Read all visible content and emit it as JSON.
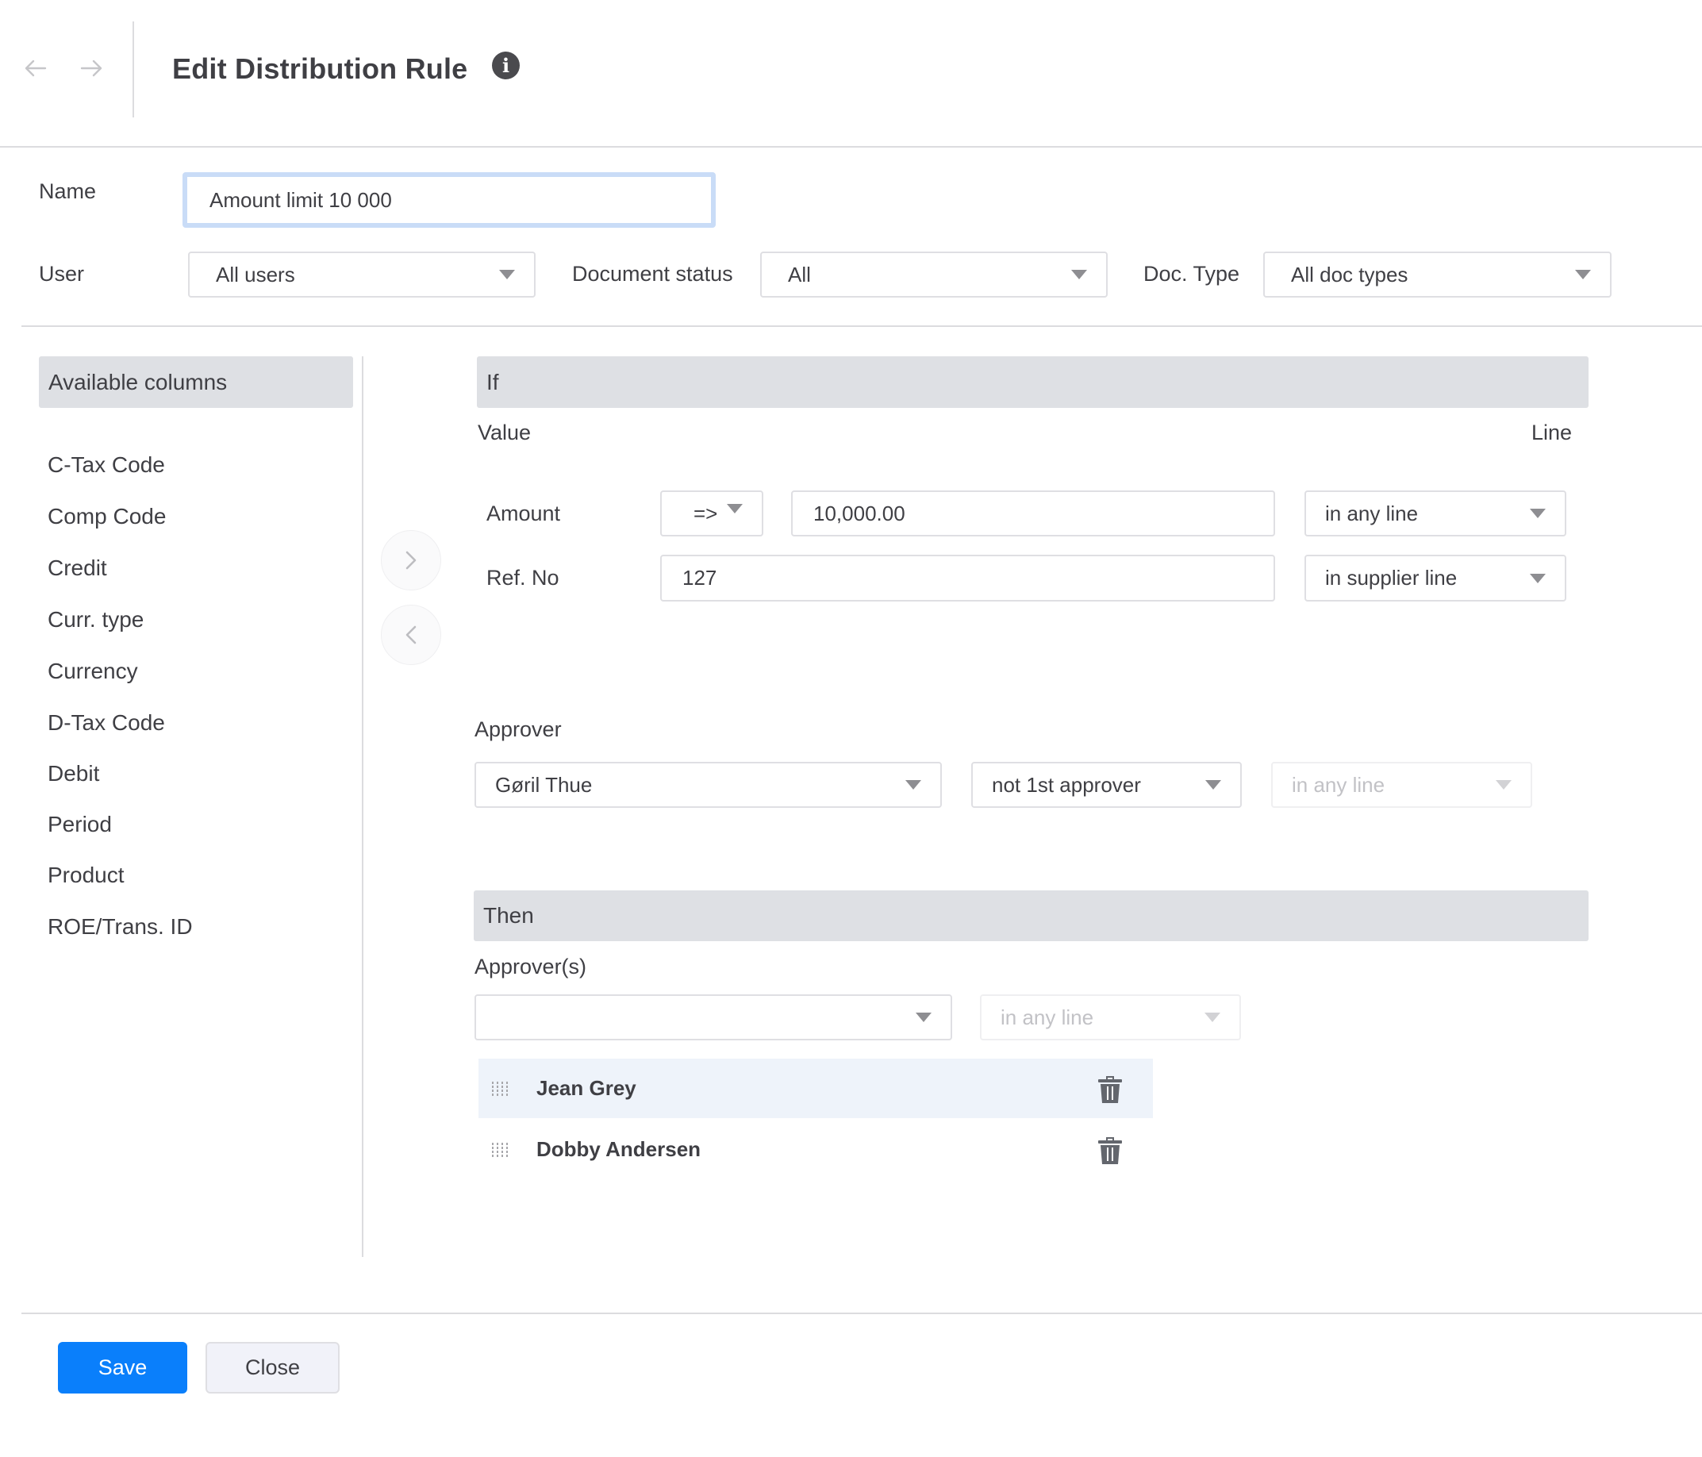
{
  "header": {
    "title": "Edit Distribution Rule",
    "back_icon": "arrow-left-icon",
    "forward_icon": "arrow-right-icon",
    "info_icon": "info-icon"
  },
  "form": {
    "name_label": "Name",
    "name_value": "Amount limit 10 000",
    "user_label": "User",
    "user_value": "All users",
    "doc_status_label": "Document status",
    "doc_status_value": "All",
    "doc_type_label": "Doc. Type",
    "doc_type_value": "All doc types"
  },
  "available_columns": {
    "header": "Available columns",
    "items": [
      "C-Tax Code",
      "Comp Code",
      "Credit",
      "Curr. type",
      "Currency",
      "D-Tax Code",
      "Debit",
      "Period",
      "Product",
      "ROE/Trans. ID"
    ],
    "move_right_icon": "chevron-right-icon",
    "move_left_icon": "chevron-left-icon"
  },
  "if_section": {
    "header": "If",
    "value_label": "Value",
    "line_label": "Line",
    "conditions": [
      {
        "field": "Amount",
        "operator": "=>",
        "value": "10,000.00",
        "line": "in any line"
      },
      {
        "field": "Ref. No",
        "value": "127",
        "line": "in supplier line"
      }
    ],
    "approver_label": "Approver",
    "approver_value": "Gøril Thue",
    "approver_qualifier": "not 1st approver",
    "approver_line": "in any line"
  },
  "then_section": {
    "header": "Then",
    "approvers_label": "Approver(s)",
    "approver_select_value": "",
    "approver_line": "in any line",
    "approvers": [
      {
        "name": "Jean Grey",
        "highlighted": true
      },
      {
        "name": "Dobby Andersen",
        "highlighted": false
      }
    ]
  },
  "footer": {
    "save_label": "Save",
    "close_label": "Close"
  },
  "colors": {
    "primary": "#0a7ffb",
    "section_header_bg": "#dee0e4",
    "highlight_row_bg": "#eef3fa",
    "focus_ring": "#c9dcf7"
  }
}
